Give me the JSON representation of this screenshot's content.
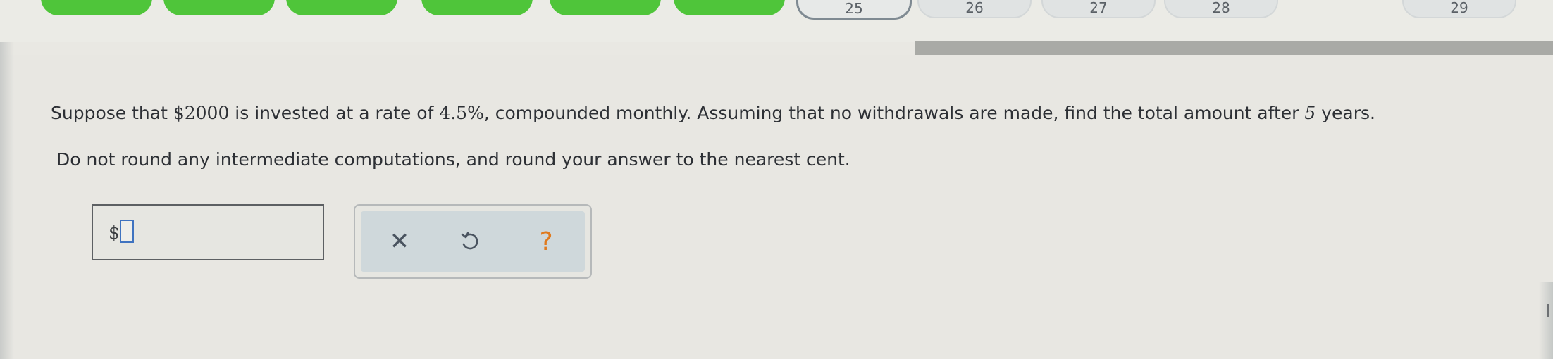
{
  "nav": {
    "question_pills": [
      {
        "number": "",
        "state": "done"
      },
      {
        "number": "",
        "state": "done"
      },
      {
        "number": "",
        "state": "done"
      },
      {
        "number": "",
        "state": "done"
      },
      {
        "number": "",
        "state": "done"
      },
      {
        "number": "",
        "state": "done"
      },
      {
        "number": "25",
        "state": "current"
      },
      {
        "number": "26",
        "state": "todo"
      },
      {
        "number": "27",
        "state": "todo"
      },
      {
        "number": "28",
        "state": "todo"
      },
      {
        "number": "29",
        "state": "todo"
      }
    ]
  },
  "question": {
    "part1": "Suppose that ",
    "amount": "$2000",
    "part2": " is invested at a rate of ",
    "rate": "4.5%",
    "part3": ", compounded monthly. Assuming that no withdrawals are made, find the total amount after ",
    "years": "5",
    "part4": " years.",
    "instruction": "Do not round any intermediate computations, and round your answer to the nearest cent."
  },
  "answer": {
    "prefix": "$",
    "value": ""
  },
  "tools": {
    "clear_symbol": "✕",
    "help_symbol": "?"
  },
  "colors": {
    "done_pill": "#4fc53a",
    "progress_bar": "#a9aaa6",
    "help_orange": "#e07a1e",
    "input_border": "#3f73c0"
  }
}
